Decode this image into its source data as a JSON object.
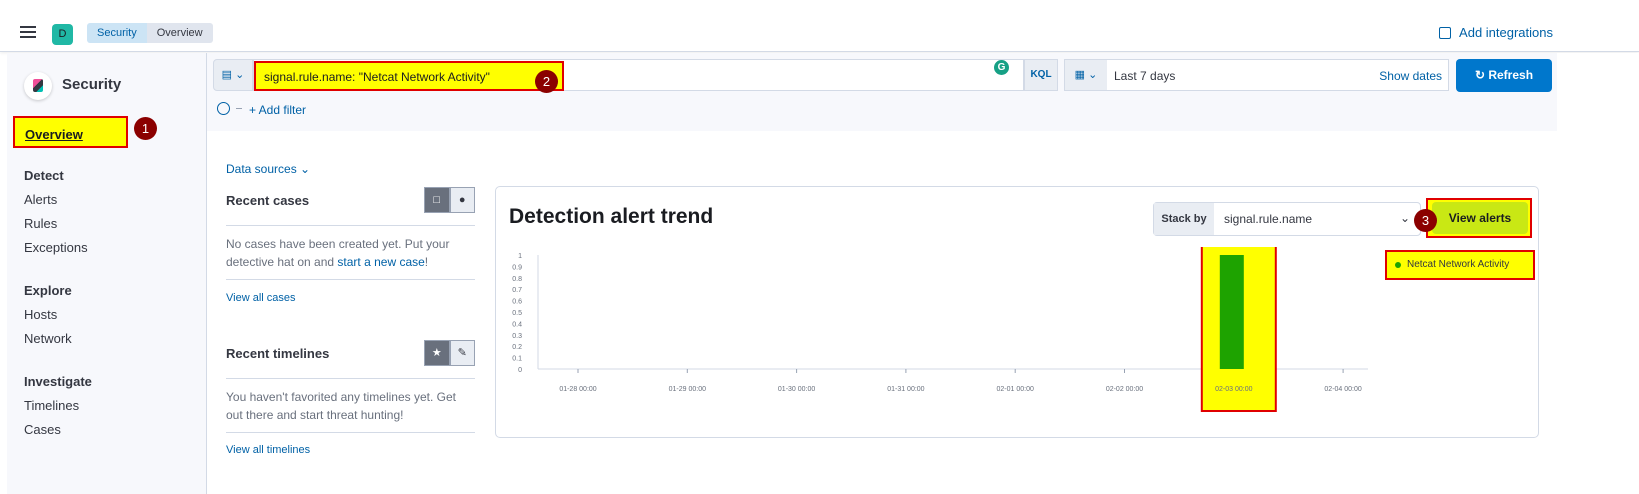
{
  "header": {
    "space_initial": "D",
    "breadcrumbs": [
      "Security",
      "Overview"
    ],
    "add_integrations": "Add integrations"
  },
  "sidebar": {
    "app_title": "Security",
    "overview": "Overview",
    "groups": [
      {
        "title": "Detect",
        "items": [
          "Alerts",
          "Rules",
          "Exceptions"
        ]
      },
      {
        "title": "Explore",
        "items": [
          "Hosts",
          "Network"
        ]
      },
      {
        "title": "Investigate",
        "items": [
          "Timelines",
          "Cases"
        ]
      }
    ]
  },
  "search": {
    "query": "signal.rule.name: \"Netcat Network Activity\"",
    "language": "KQL",
    "date_range": "Last 7 days",
    "show_dates": "Show dates",
    "refresh": "Refresh",
    "add_filter": "+ Add filter"
  },
  "annotations": [
    "1",
    "2",
    "3"
  ],
  "overview": {
    "data_sources": "Data sources",
    "recent_cases": {
      "title": "Recent cases",
      "text_before": "No cases have been created yet. Put your detective hat on and ",
      "link": "start a new case",
      "text_after": "!",
      "view_all": "View all cases"
    },
    "recent_timelines": {
      "title": "Recent timelines",
      "text": "You haven't favorited any timelines yet. Get out there and start threat hunting!",
      "view_all": "View all timelines"
    }
  },
  "trend": {
    "title": "Detection alert trend",
    "stack_by_label": "Stack by",
    "stack_by_value": "signal.rule.name",
    "view_alerts": "View alerts",
    "legend": "Netcat Network Activity"
  },
  "chart_data": {
    "type": "bar",
    "x": [
      "01-28 00:00",
      "01-29 00:00",
      "01-30 00:00",
      "01-31 00:00",
      "02-01 00:00",
      "02-02 00:00",
      "02-03 00:00",
      "02-04 00:00"
    ],
    "y_ticks": [
      "0",
      "0.1",
      "0.2",
      "0.3",
      "0.4",
      "0.5",
      "0.6",
      "0.7",
      "0.8",
      "0.9",
      "1"
    ],
    "ylim": [
      0,
      1
    ],
    "series": [
      {
        "name": "Netcat Network Activity",
        "color": "#1ea300",
        "points": [
          {
            "x": "02-03 00:00",
            "y": 1
          }
        ]
      }
    ],
    "grid": false,
    "legend_position": "top-right"
  }
}
